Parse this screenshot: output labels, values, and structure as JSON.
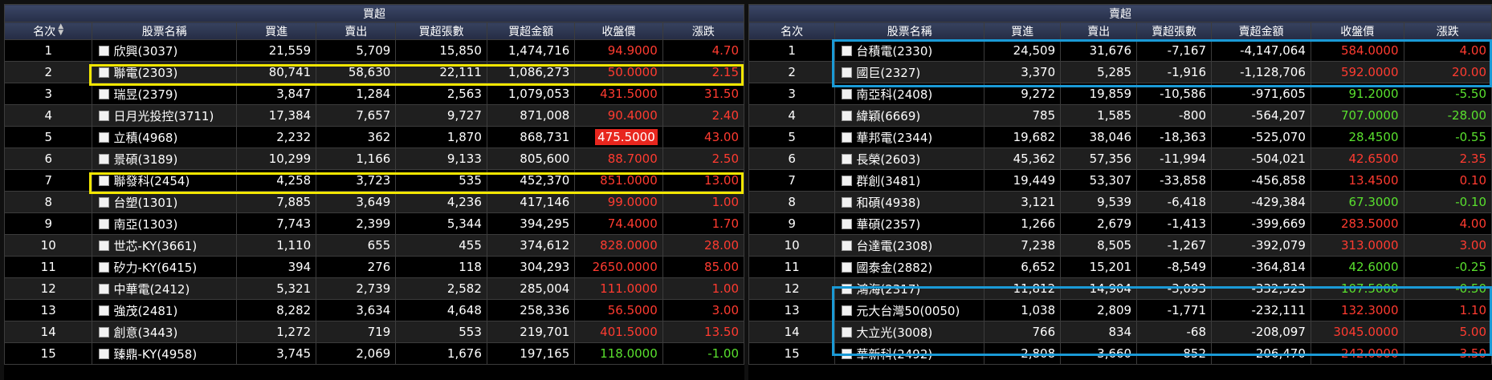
{
  "colors": {
    "up": "#ff3b30",
    "down": "#59e02e",
    "highlight_bg": "#e8261e",
    "yellow_box": "#f2e600",
    "blue_box": "#1a9ad6"
  },
  "buy": {
    "title": "買超",
    "headers": [
      "名次",
      "股票名稱",
      "買進",
      "賣出",
      "買超張數",
      "買超金額",
      "收盤價",
      "漲跌"
    ],
    "rows": [
      {
        "rank": "1",
        "name": "欣興(3037)",
        "buy": "21,559",
        "sell": "5,709",
        "net": "15,850",
        "amount": "1,474,716",
        "close": "94.9000",
        "change": "4.70",
        "trend": "up"
      },
      {
        "rank": "2",
        "name": "聯電(2303)",
        "buy": "80,741",
        "sell": "58,630",
        "net": "22,111",
        "amount": "1,086,273",
        "close": "50.0000",
        "change": "2.15",
        "trend": "up"
      },
      {
        "rank": "3",
        "name": "瑞昱(2379)",
        "buy": "3,847",
        "sell": "1,284",
        "net": "2,563",
        "amount": "1,079,053",
        "close": "431.5000",
        "change": "31.50",
        "trend": "up"
      },
      {
        "rank": "4",
        "name": "日月光投控(3711)",
        "buy": "17,384",
        "sell": "7,657",
        "net": "9,727",
        "amount": "871,008",
        "close": "90.4000",
        "change": "2.40",
        "trend": "up"
      },
      {
        "rank": "5",
        "name": "立積(4968)",
        "buy": "2,232",
        "sell": "362",
        "net": "1,870",
        "amount": "868,731",
        "close": "475.5000",
        "change": "43.00",
        "trend": "limit"
      },
      {
        "rank": "6",
        "name": "景碩(3189)",
        "buy": "10,299",
        "sell": "1,166",
        "net": "9,133",
        "amount": "805,600",
        "close": "88.7000",
        "change": "2.50",
        "trend": "up"
      },
      {
        "rank": "7",
        "name": "聯發科(2454)",
        "buy": "4,258",
        "sell": "3,723",
        "net": "535",
        "amount": "452,370",
        "close": "851.0000",
        "change": "13.00",
        "trend": "up"
      },
      {
        "rank": "8",
        "name": "台塑(1301)",
        "buy": "7,885",
        "sell": "3,649",
        "net": "4,236",
        "amount": "417,146",
        "close": "99.0000",
        "change": "1.00",
        "trend": "up"
      },
      {
        "rank": "9",
        "name": "南亞(1303)",
        "buy": "7,743",
        "sell": "2,399",
        "net": "5,344",
        "amount": "394,295",
        "close": "74.4000",
        "change": "1.70",
        "trend": "up"
      },
      {
        "rank": "10",
        "name": "世芯-KY(3661)",
        "buy": "1,110",
        "sell": "655",
        "net": "455",
        "amount": "374,612",
        "close": "828.0000",
        "change": "28.00",
        "trend": "up"
      },
      {
        "rank": "11",
        "name": "矽力-KY(6415)",
        "buy": "394",
        "sell": "276",
        "net": "118",
        "amount": "304,293",
        "close": "2650.0000",
        "change": "85.00",
        "trend": "up"
      },
      {
        "rank": "12",
        "name": "中華電(2412)",
        "buy": "5,321",
        "sell": "2,739",
        "net": "2,582",
        "amount": "285,004",
        "close": "111.0000",
        "change": "1.00",
        "trend": "up"
      },
      {
        "rank": "13",
        "name": "強茂(2481)",
        "buy": "8,282",
        "sell": "3,634",
        "net": "4,648",
        "amount": "258,336",
        "close": "56.5000",
        "change": "3.00",
        "trend": "up"
      },
      {
        "rank": "14",
        "name": "創意(3443)",
        "buy": "1,272",
        "sell": "719",
        "net": "553",
        "amount": "219,701",
        "close": "401.5000",
        "change": "13.50",
        "trend": "up"
      },
      {
        "rank": "15",
        "name": "臻鼎-KY(4958)",
        "buy": "3,745",
        "sell": "2,069",
        "net": "1,676",
        "amount": "197,165",
        "close": "118.0000",
        "change": "-1.00",
        "trend": "down"
      }
    ]
  },
  "sell": {
    "title": "賣超",
    "headers": [
      "名次",
      "股票名稱",
      "買進",
      "賣出",
      "賣超張數",
      "賣超金額",
      "收盤價",
      "漲跌"
    ],
    "rows": [
      {
        "rank": "1",
        "name": "台積電(2330)",
        "buy": "24,509",
        "sell": "31,676",
        "net": "-7,167",
        "amount": "-4,147,064",
        "close": "584.0000",
        "change": "4.00",
        "trend": "up"
      },
      {
        "rank": "2",
        "name": "國巨(2327)",
        "buy": "3,370",
        "sell": "5,285",
        "net": "-1,916",
        "amount": "-1,128,706",
        "close": "592.0000",
        "change": "20.00",
        "trend": "up"
      },
      {
        "rank": "3",
        "name": "南亞科(2408)",
        "buy": "9,272",
        "sell": "19,859",
        "net": "-10,586",
        "amount": "-971,605",
        "close": "91.2000",
        "change": "-5.50",
        "trend": "down"
      },
      {
        "rank": "4",
        "name": "緯穎(6669)",
        "buy": "785",
        "sell": "1,585",
        "net": "-800",
        "amount": "-564,207",
        "close": "707.0000",
        "change": "-28.00",
        "trend": "down"
      },
      {
        "rank": "5",
        "name": "華邦電(2344)",
        "buy": "19,682",
        "sell": "38,046",
        "net": "-18,363",
        "amount": "-525,070",
        "close": "28.4500",
        "change": "-0.55",
        "trend": "down"
      },
      {
        "rank": "6",
        "name": "長榮(2603)",
        "buy": "45,362",
        "sell": "57,356",
        "net": "-11,994",
        "amount": "-504,021",
        "close": "42.6500",
        "change": "2.35",
        "trend": "up"
      },
      {
        "rank": "7",
        "name": "群創(3481)",
        "buy": "19,449",
        "sell": "53,307",
        "net": "-33,858",
        "amount": "-456,858",
        "close": "13.4500",
        "change": "0.10",
        "trend": "up"
      },
      {
        "rank": "8",
        "name": "和碩(4938)",
        "buy": "3,121",
        "sell": "9,539",
        "net": "-6,418",
        "amount": "-429,384",
        "close": "67.3000",
        "change": "-0.10",
        "trend": "down"
      },
      {
        "rank": "9",
        "name": "華碩(2357)",
        "buy": "1,266",
        "sell": "2,679",
        "net": "-1,413",
        "amount": "-399,669",
        "close": "283.5000",
        "change": "4.00",
        "trend": "up"
      },
      {
        "rank": "10",
        "name": "台達電(2308)",
        "buy": "7,238",
        "sell": "8,505",
        "net": "-1,267",
        "amount": "-392,079",
        "close": "313.0000",
        "change": "3.00",
        "trend": "up"
      },
      {
        "rank": "11",
        "name": "國泰金(2882)",
        "buy": "6,652",
        "sell": "15,201",
        "net": "-8,549",
        "amount": "-364,814",
        "close": "42.6000",
        "change": "-0.25",
        "trend": "down"
      },
      {
        "rank": "12",
        "name": "鴻海(2317)",
        "buy": "11,812",
        "sell": "14,904",
        "net": "-3,093",
        "amount": "-332,523",
        "close": "107.5000",
        "change": "-0.50",
        "trend": "down"
      },
      {
        "rank": "13",
        "name": "元大台灣50(0050)",
        "buy": "1,038",
        "sell": "2,809",
        "net": "-1,771",
        "amount": "-232,111",
        "close": "132.3000",
        "change": "1.10",
        "trend": "up"
      },
      {
        "rank": "14",
        "name": "大立光(3008)",
        "buy": "766",
        "sell": "834",
        "net": "-68",
        "amount": "-208,097",
        "close": "3045.0000",
        "change": "5.00",
        "trend": "up"
      },
      {
        "rank": "15",
        "name": "華新科(2492)",
        "buy": "2,808",
        "sell": "3,660",
        "net": "-852",
        "amount": "-206,470",
        "close": "242.0000",
        "change": "3.50",
        "trend": "up"
      }
    ]
  }
}
